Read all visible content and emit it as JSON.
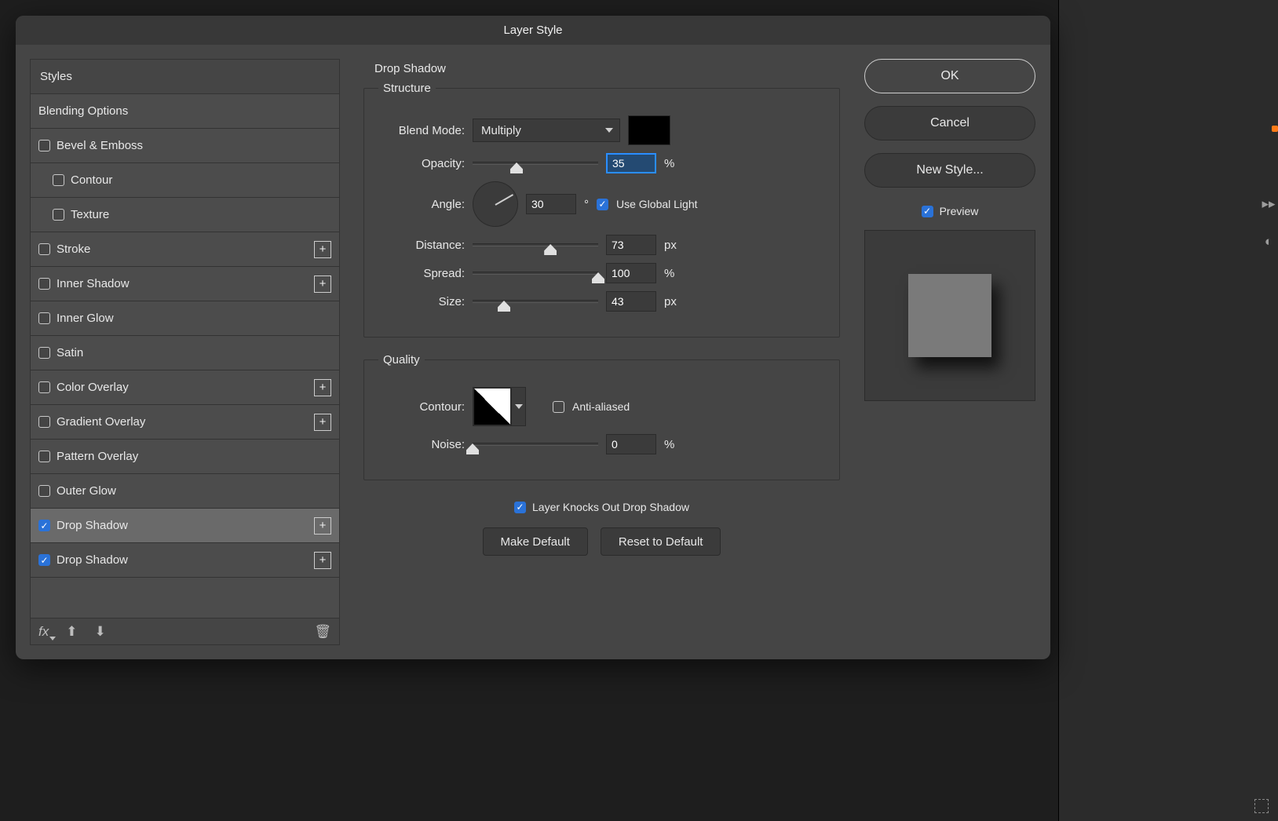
{
  "dialog": {
    "title": "Layer Style"
  },
  "sidebar": {
    "header": "Styles",
    "items": [
      {
        "label": "Blending Options",
        "checked": null,
        "add": false,
        "indent": false,
        "selected": false
      },
      {
        "label": "Bevel & Emboss",
        "checked": false,
        "add": false,
        "indent": false,
        "selected": false
      },
      {
        "label": "Contour",
        "checked": false,
        "add": false,
        "indent": true,
        "selected": false
      },
      {
        "label": "Texture",
        "checked": false,
        "add": false,
        "indent": true,
        "selected": false
      },
      {
        "label": "Stroke",
        "checked": false,
        "add": true,
        "indent": false,
        "selected": false
      },
      {
        "label": "Inner Shadow",
        "checked": false,
        "add": true,
        "indent": false,
        "selected": false
      },
      {
        "label": "Inner Glow",
        "checked": false,
        "add": false,
        "indent": false,
        "selected": false
      },
      {
        "label": "Satin",
        "checked": false,
        "add": false,
        "indent": false,
        "selected": false
      },
      {
        "label": "Color Overlay",
        "checked": false,
        "add": true,
        "indent": false,
        "selected": false
      },
      {
        "label": "Gradient Overlay",
        "checked": false,
        "add": true,
        "indent": false,
        "selected": false
      },
      {
        "label": "Pattern Overlay",
        "checked": false,
        "add": false,
        "indent": false,
        "selected": false
      },
      {
        "label": "Outer Glow",
        "checked": false,
        "add": false,
        "indent": false,
        "selected": false
      },
      {
        "label": "Drop Shadow",
        "checked": true,
        "add": true,
        "indent": false,
        "selected": true
      },
      {
        "label": "Drop Shadow",
        "checked": true,
        "add": true,
        "indent": false,
        "selected": false
      }
    ],
    "fx_label": "fx"
  },
  "panel": {
    "title": "Drop Shadow",
    "structure": {
      "legend": "Structure",
      "blend_mode_label": "Blend Mode:",
      "blend_mode_value": "Multiply",
      "color": "#000000",
      "opacity_label": "Opacity:",
      "opacity_value": "35",
      "opacity_unit": "%",
      "opacity_pct": 35,
      "angle_label": "Angle:",
      "angle_value": "30",
      "angle_unit": "°",
      "use_global_light_label": "Use Global Light",
      "use_global_light": true,
      "distance_label": "Distance:",
      "distance_value": "73",
      "distance_unit": "px",
      "distance_pct": 62,
      "spread_label": "Spread:",
      "spread_value": "100",
      "spread_unit": "%",
      "spread_pct": 100,
      "size_label": "Size:",
      "size_value": "43",
      "size_unit": "px",
      "size_pct": 25
    },
    "quality": {
      "legend": "Quality",
      "contour_label": "Contour:",
      "anti_aliased_label": "Anti-aliased",
      "anti_aliased": false,
      "noise_label": "Noise:",
      "noise_value": "0",
      "noise_unit": "%",
      "noise_pct": 0
    },
    "knockout_label": "Layer Knocks Out Drop Shadow",
    "knockout": true,
    "make_default_label": "Make Default",
    "reset_default_label": "Reset to Default"
  },
  "actions": {
    "ok": "OK",
    "cancel": "Cancel",
    "new_style": "New Style...",
    "preview_label": "Preview",
    "preview_checked": true
  }
}
